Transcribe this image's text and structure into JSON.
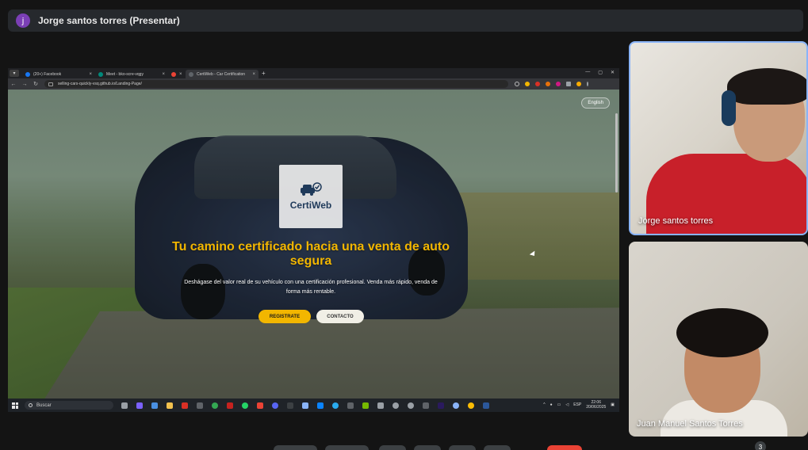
{
  "presenter": {
    "avatar_letter": "j",
    "title": "Jorge santos torres (Presentar)"
  },
  "browser": {
    "tabs": [
      {
        "label": "(20+) Facebook",
        "fav_color": "#1877f2",
        "close": "×",
        "active": false
      },
      {
        "label": "Meet - bko-scre-vqgy",
        "fav_color": "#00897b",
        "close": "×",
        "active": false
      },
      {
        "label": "",
        "fav_color": "#ea4335",
        "close": "×",
        "active": false
      },
      {
        "label": "CertiWeb - Car Certification",
        "fav_color": "#5f6368",
        "close": "×",
        "active": true
      }
    ],
    "new_tab": "+",
    "url": "selling-cars-quickly-vsq.github.io/Landing-Page/"
  },
  "site": {
    "language_button": "English",
    "logo_text": "CertiWeb",
    "hero_title": "Tu camino certificado hacia una venta de auto segura",
    "hero_subtitle": "Deshágase del valor real de su vehículo con una certificación profesional. Venda más rápido, venda de forma más rentable.",
    "cta_primary": "REGISTRATE",
    "cta_secondary": "CONTACTO",
    "accent_color": "#f2b600"
  },
  "taskbar": {
    "search_placeholder": "Buscar",
    "lang": "ESP",
    "time": "22:06",
    "date": "20/06/2025"
  },
  "participants": [
    {
      "name": "Jorge santos torres"
    },
    {
      "name": "Juan Manuel Santos Torres"
    }
  ],
  "controls": {
    "participant_badge": "3"
  }
}
